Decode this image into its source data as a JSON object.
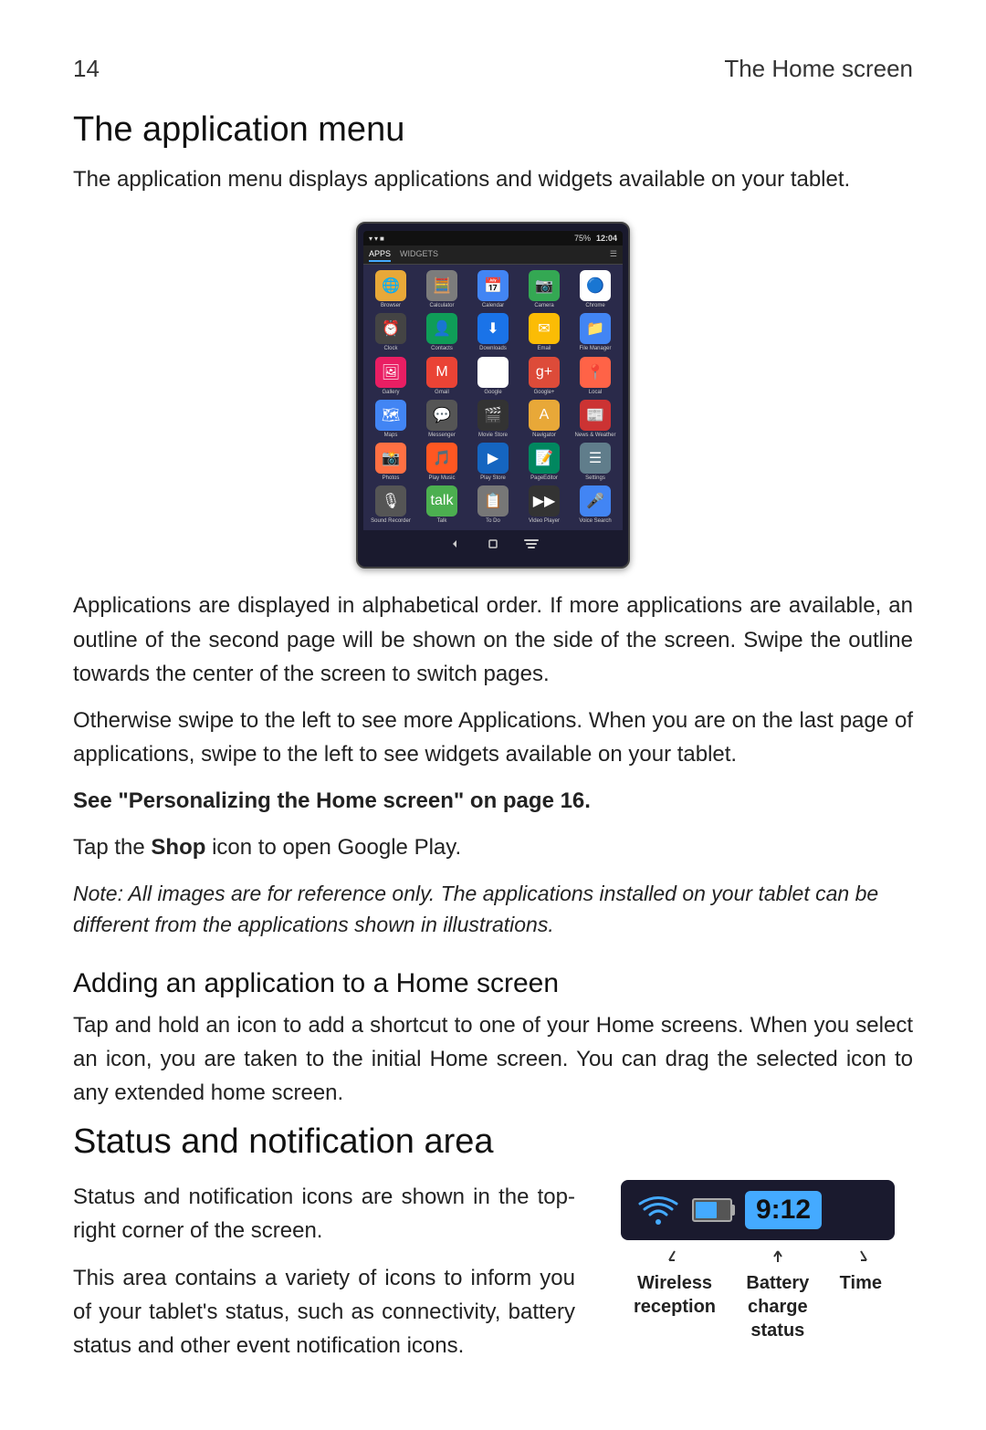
{
  "header": {
    "page_number": "14",
    "page_title": "The Home screen"
  },
  "application_menu_section": {
    "title": "The application menu",
    "description": "The application menu displays applications and widgets available on your tablet.",
    "tablet": {
      "status_bar": {
        "icons": "▾ ▾ ■",
        "battery": "75%",
        "time": "12:04"
      },
      "tabs": [
        "APPS",
        "WIDGETS"
      ],
      "settings_icon": "☰",
      "apps": [
        {
          "label": "Browser",
          "icon": "🌐",
          "color": "icon-browser"
        },
        {
          "label": "Calculator",
          "icon": "🧮",
          "color": "icon-calc"
        },
        {
          "label": "Calendar",
          "icon": "📅",
          "color": "icon-calendar"
        },
        {
          "label": "Camera",
          "icon": "📷",
          "color": "icon-camera"
        },
        {
          "label": "Chrome",
          "icon": "🔵",
          "color": "icon-chrome"
        },
        {
          "label": "Clock",
          "icon": "⏰",
          "color": "icon-clock"
        },
        {
          "label": "Contacts",
          "icon": "👤",
          "color": "icon-contacts"
        },
        {
          "label": "Downloads",
          "icon": "⬇",
          "color": "icon-downloads"
        },
        {
          "label": "Email",
          "icon": "✉",
          "color": "icon-email"
        },
        {
          "label": "File Manager",
          "icon": "📁",
          "color": "icon-files"
        },
        {
          "label": "Gallery",
          "icon": "🖼",
          "color": "icon-gallery"
        },
        {
          "label": "Gmail",
          "icon": "M",
          "color": "icon-gmail"
        },
        {
          "label": "Google",
          "icon": "G",
          "color": "icon-google"
        },
        {
          "label": "Google+",
          "icon": "g+",
          "color": "icon-gplus"
        },
        {
          "label": "Local",
          "icon": "📍",
          "color": "icon-local"
        },
        {
          "label": "Maps",
          "icon": "🗺",
          "color": "icon-maps"
        },
        {
          "label": "Messenger",
          "icon": "💬",
          "color": "icon-messenger"
        },
        {
          "label": "Movie Store",
          "icon": "🎬",
          "color": "icon-movie"
        },
        {
          "label": "Navigator",
          "icon": "A",
          "color": "icon-navigator"
        },
        {
          "label": "News & Weather",
          "icon": "📰",
          "color": "icon-news"
        },
        {
          "label": "Photos",
          "icon": "📸",
          "color": "icon-photos"
        },
        {
          "label": "Play Music",
          "icon": "🎵",
          "color": "icon-playmusic"
        },
        {
          "label": "Play Store",
          "icon": "▶",
          "color": "icon-playmovies"
        },
        {
          "label": "PageEditor",
          "icon": "📝",
          "color": "icon-playstore"
        },
        {
          "label": "Settings",
          "icon": "☰",
          "color": "icon-settings"
        },
        {
          "label": "Sound Recorder",
          "icon": "🎙",
          "color": "icon-soundrec"
        },
        {
          "label": "Talk",
          "icon": "talk",
          "color": "icon-talk"
        },
        {
          "label": "To Do",
          "icon": "📋",
          "color": "icon-todo"
        },
        {
          "label": "Video Player",
          "icon": "▶▶",
          "color": "icon-vidplayer"
        },
        {
          "label": "Voice Search",
          "icon": "🎤",
          "color": "icon-voicesearch"
        }
      ]
    },
    "paragraph1": "Applications are displayed in alphabetical order. If more applications are available, an outline of the second page will be shown on the side of the screen. Swipe the outline towards the center of the screen to switch pages.",
    "paragraph2": "Otherwise swipe to the left to see more Applications. When you are on the last page of applications, swipe to the left to see widgets available on your tablet.",
    "bold_text": "See \"Personalizing the Home screen\" on page 16.",
    "tap_text": "Tap the ",
    "shop_bold": "Shop",
    "after_shop": " icon to open Google Play.",
    "note": "Note: All images are for reference only. The applications installed on your tablet can be different from the applications shown in illustrations."
  },
  "adding_section": {
    "title": "Adding an application to a Home screen",
    "description": "Tap and hold an icon to add a shortcut to one of your Home screens. When you select an icon, you are taken to the initial Home screen. You can drag the selected icon to any extended home screen."
  },
  "status_section": {
    "title": "Status and notification area",
    "description1": "Status and notification icons are shown in the top-right corner of the screen.",
    "description2": "This area contains a variety of icons to inform you of your tablet's status, such as connectivity, battery status and other event notification icons.",
    "image": {
      "time": "9:12"
    },
    "labels": {
      "wireless": "Wireless\nreception",
      "battery": "Battery\ncharge\nstatus",
      "time": "Time"
    }
  }
}
